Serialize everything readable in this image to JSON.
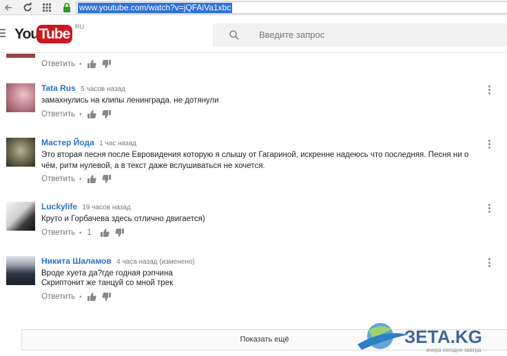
{
  "browser": {
    "url": "www.youtube.com/watch?v=jQFAiVa1xbc"
  },
  "header": {
    "logo_you": "You",
    "logo_tube": "Tube",
    "logo_region": "RU",
    "search_placeholder": "Введите запрос"
  },
  "top_comment": {
    "reply_label": "Ответить"
  },
  "comments": [
    {
      "author": "Tata Rus",
      "time": "5 часов назад",
      "text": "замахнулись на клипы ленинграда. не дотянули",
      "reply_label": "Ответить"
    },
    {
      "author": "Мастер Йода",
      "time": "1 час назад",
      "text": "Это вторая песня после Евровидения которую я слышу от Гагариной, искренне надеюсь что последняя. Песня ни о чём, ритм нулевой, а в текст даже вслушиваться не хочется.",
      "reply_label": "Ответить"
    },
    {
      "author": "Luckylife",
      "time": "19 часов назад",
      "text": "Круто и Горбачева здесь отлично двигается)",
      "reply_label": "Ответить",
      "likes": "1"
    },
    {
      "author": "Никита Шаламов",
      "time": "4 часа назад (изменено)",
      "text_line1": "Вроде хуета да?где годная рэпчина",
      "text_line2": "Скриптонит же танцуй со мной трек",
      "reply_label": "Ответить"
    }
  ],
  "show_more_label": "Показать ещё",
  "watermark": {
    "brand": "ЗЕТА.KG",
    "tagline": "вчера сегодня завтра"
  },
  "colors": {
    "author_link": "#2a72c8",
    "youtube_red": "#cc181e",
    "url_highlight": "#3072d8"
  }
}
